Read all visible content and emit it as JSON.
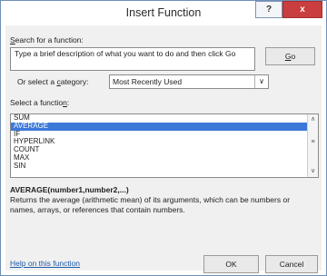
{
  "window": {
    "title": "Insert Function",
    "help_button": "?",
    "close_button": "x"
  },
  "search": {
    "label_prefix": "",
    "label_accel": "S",
    "label_rest": "earch for a function:",
    "value": "Type a brief description of what you want to do and then click Go",
    "go_accel": "G",
    "go_rest": "o"
  },
  "category": {
    "label_prefix": "Or select a ",
    "label_accel": "c",
    "label_rest": "ategory:",
    "selected": "Most Recently Used"
  },
  "function_list": {
    "label_prefix": "Select a functio",
    "label_accel": "n",
    "label_rest": ":",
    "items": [
      "SUM",
      "AVERAGE",
      "IF",
      "HYPERLINK",
      "COUNT",
      "MAX",
      "SIN"
    ],
    "selected": "AVERAGE"
  },
  "details": {
    "syntax": "AVERAGE(number1,number2,...)",
    "description": "Returns the average (arithmetic mean) of its arguments, which can be numbers or names, arrays, or references that contain numbers."
  },
  "footer": {
    "help_link": "Help on this function",
    "ok": "OK",
    "cancel": "Cancel"
  }
}
